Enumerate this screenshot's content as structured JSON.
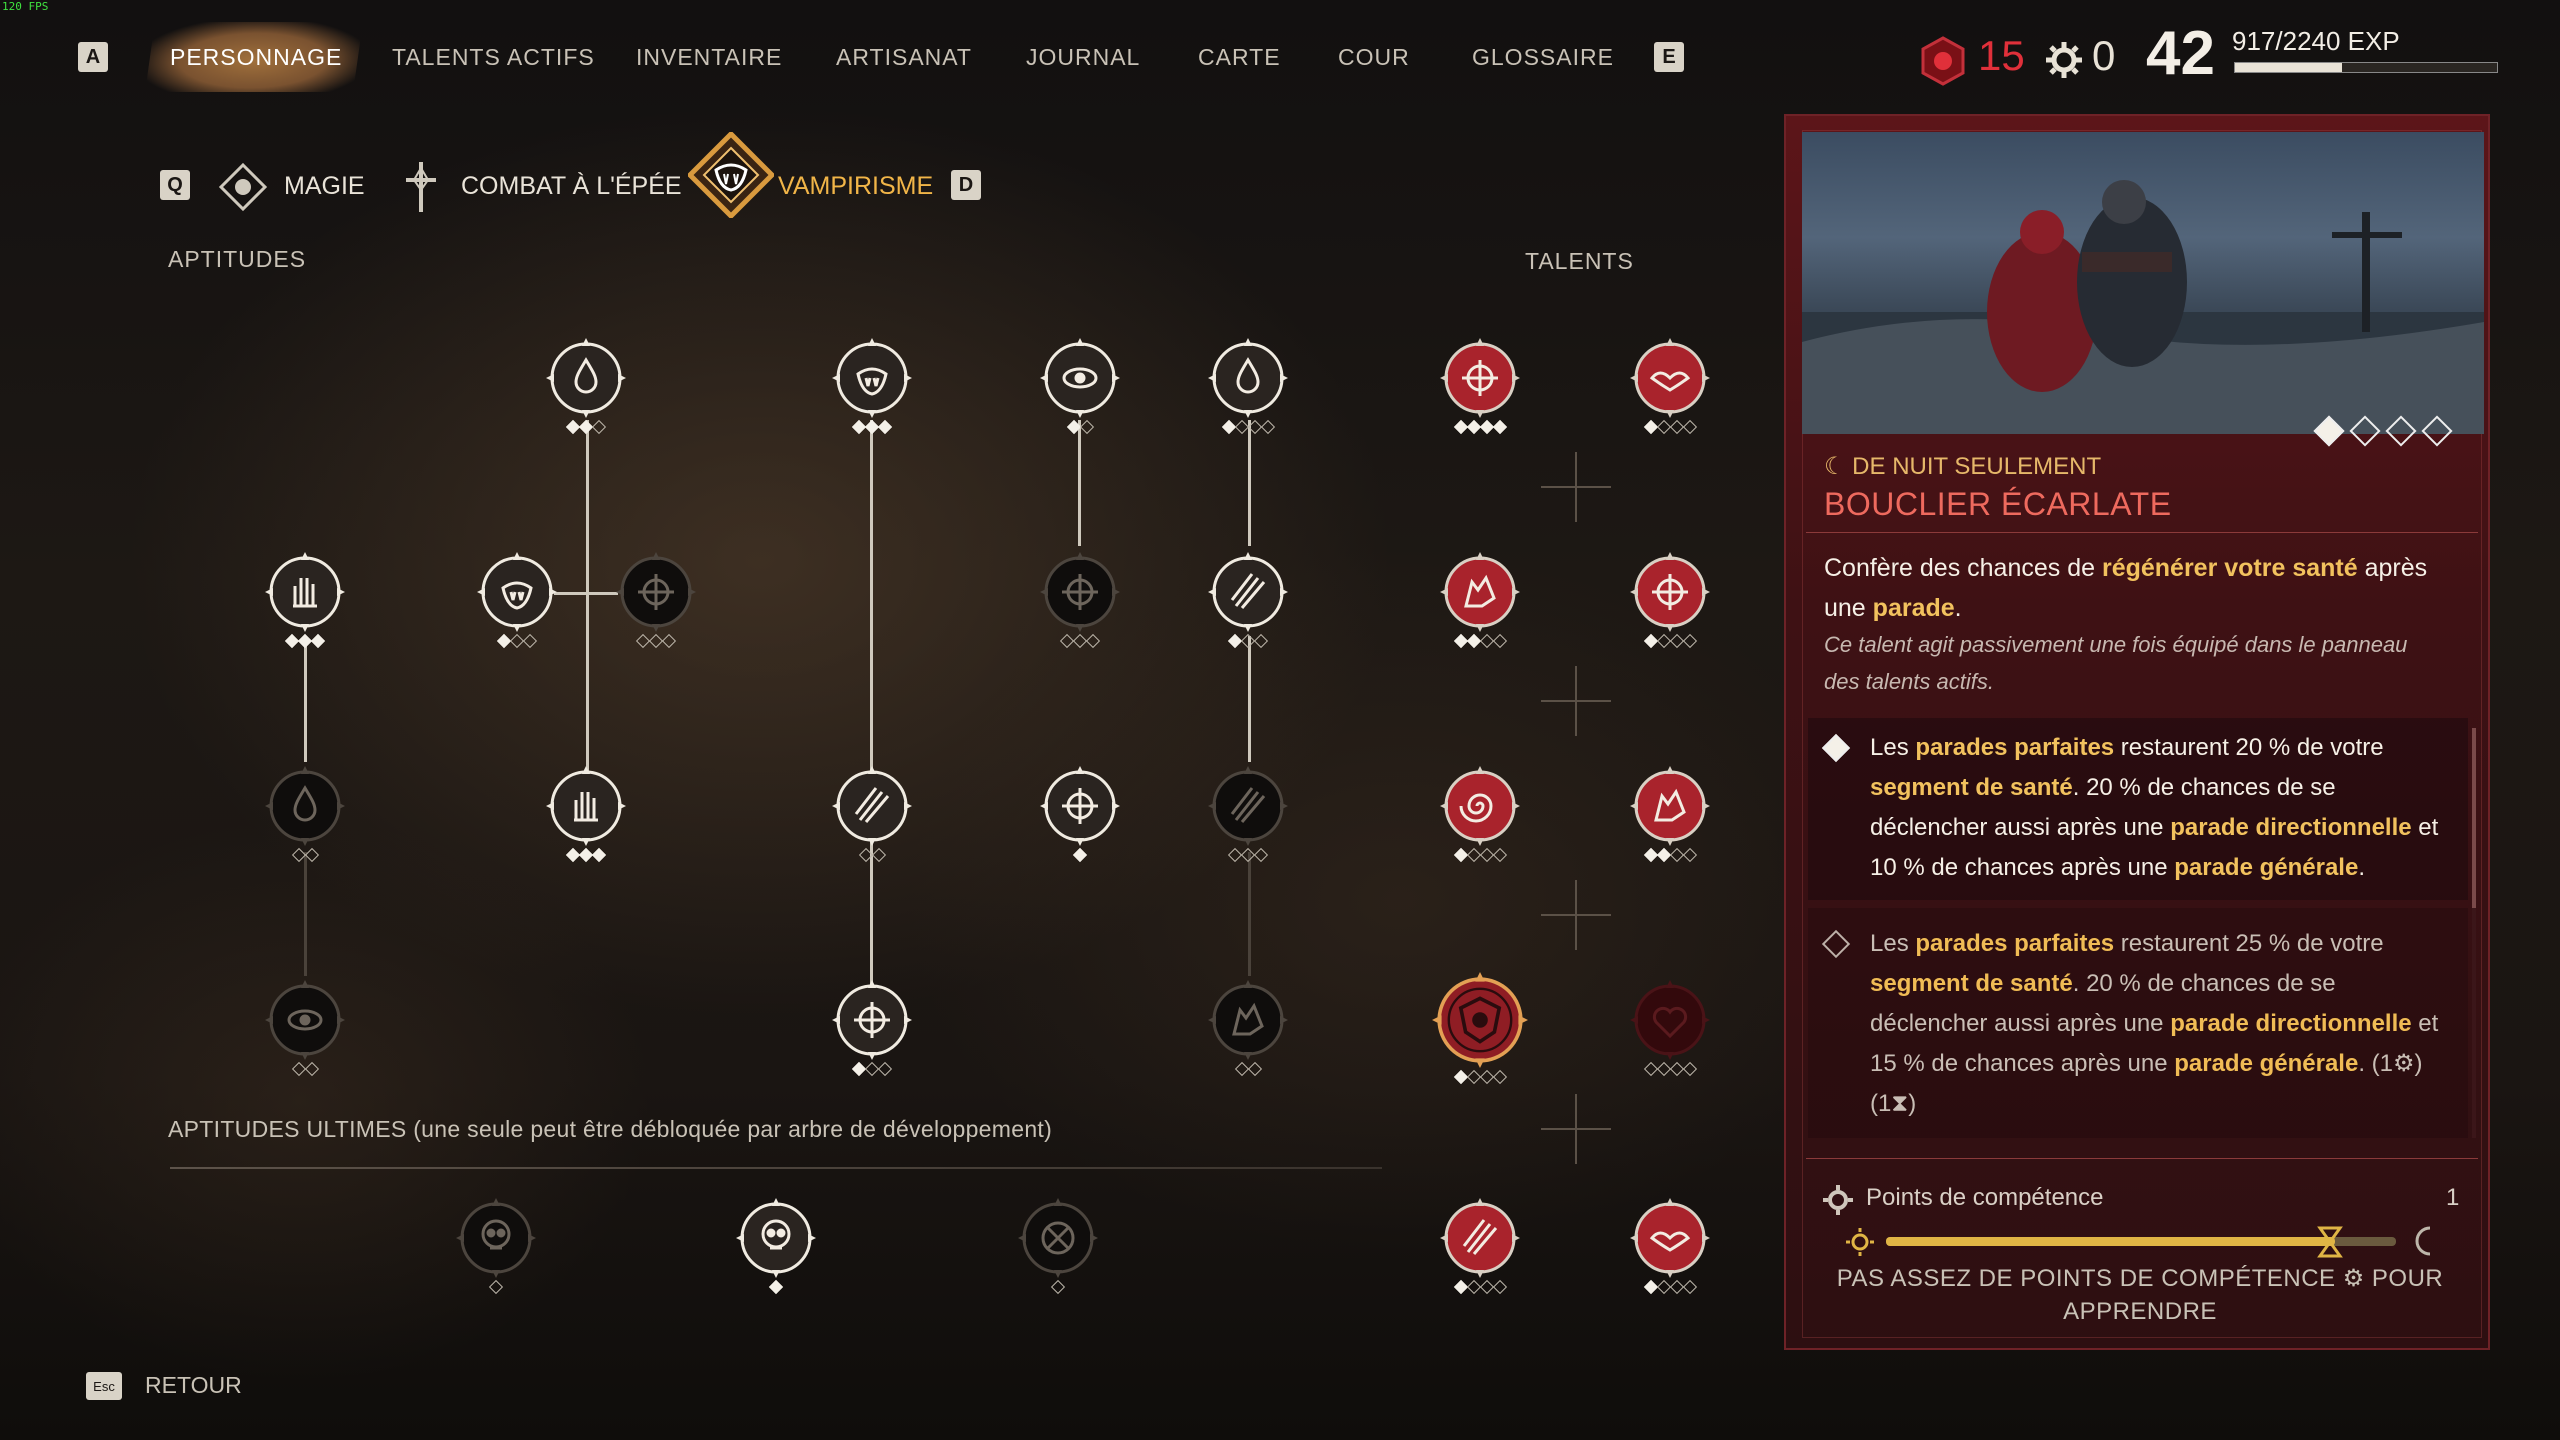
{
  "hud": {
    "fps": "120 FPS"
  },
  "nav": {
    "left_key": "A",
    "right_key": "E",
    "items": [
      "PERSONNAGE",
      "TALENTS ACTIFS",
      "INVENTAIRE",
      "ARTISANAT",
      "JOURNAL",
      "CARTE",
      "COUR",
      "GLOSSAIRE"
    ],
    "active_index": 0
  },
  "stats": {
    "blood_points": "15",
    "skill_points": "0",
    "level": "42",
    "exp": "917/2240 EXP",
    "exp_fraction": 0.409
  },
  "tree_tabs": {
    "left_key": "Q",
    "right_key": "D",
    "tabs": [
      "MAGIE",
      "COMBAT À L'ÉPÉE",
      "VAMPIRISME"
    ],
    "active_index": 2
  },
  "sections": {
    "abilities": "APTITUDES",
    "talents": "TALENTS",
    "ultimates": "APTITUDES ULTIMES (une seule peut être débloquée par arbre de développement)"
  },
  "abilities": [
    {
      "icon": "blood-drop-splash-icon",
      "ranks": 3,
      "filled": 2,
      "unlocked": true
    },
    {
      "icon": "vampire-mouth-icon",
      "ranks": 3,
      "filled": 3,
      "unlocked": true
    },
    {
      "icon": "eye-sigil-icon",
      "ranks": 2,
      "filled": 1,
      "unlocked": true
    },
    {
      "icon": "blood-drops-icon",
      "ranks": 4,
      "filled": 1,
      "unlocked": true
    },
    {
      "icon": "flame-hand-icon",
      "ranks": 3,
      "filled": 3,
      "unlocked": true
    },
    {
      "icon": "fangs-icon",
      "ranks": 3,
      "filled": 1,
      "unlocked": true
    },
    {
      "icon": "spiked-orb-icon",
      "ranks": 3,
      "filled": 0,
      "unlocked": false
    },
    {
      "icon": "hooded-figure-icon",
      "ranks": 3,
      "filled": 0,
      "unlocked": false
    },
    {
      "icon": "claw-slash-icon",
      "ranks": 3,
      "filled": 1,
      "unlocked": true
    },
    {
      "icon": "tears-drops-icon",
      "ranks": 2,
      "filled": 0,
      "unlocked": false
    },
    {
      "icon": "blood-hand-icon",
      "ranks": 3,
      "filled": 3,
      "unlocked": true
    },
    {
      "icon": "slash-marks-icon",
      "ranks": 2,
      "filled": 0,
      "unlocked": true
    },
    {
      "icon": "rose-bloom-icon",
      "ranks": 1,
      "filled": 1,
      "unlocked": true
    },
    {
      "icon": "claws-icon",
      "ranks": 3,
      "filled": 0,
      "unlocked": false
    },
    {
      "icon": "eye-portal-icon",
      "ranks": 2,
      "filled": 0,
      "unlocked": false
    },
    {
      "icon": "blood-spout-icon",
      "ranks": 3,
      "filled": 1,
      "unlocked": true
    },
    {
      "icon": "wolf-icon",
      "ranks": 2,
      "filled": 0,
      "unlocked": false
    }
  ],
  "talents": [
    {
      "icon": "blood-bloom-icon",
      "ranks": 4,
      "filled": 4,
      "state": "unlocked"
    },
    {
      "icon": "bat-wing-icon",
      "ranks": 4,
      "filled": 1,
      "state": "unlocked"
    },
    {
      "icon": "wolf-head-icon",
      "ranks": 4,
      "filled": 2,
      "state": "unlocked"
    },
    {
      "icon": "burst-icon",
      "ranks": 4,
      "filled": 1,
      "state": "unlocked"
    },
    {
      "icon": "spiral-icon",
      "ranks": 4,
      "filled": 1,
      "state": "unlocked"
    },
    {
      "icon": "howl-icon",
      "ranks": 4,
      "filled": 2,
      "state": "unlocked"
    },
    {
      "icon": "scarlet-shield-icon",
      "ranks": 4,
      "filled": 1,
      "state": "selected"
    },
    {
      "icon": "heart-icon",
      "ranks": 4,
      "filled": 0,
      "state": "locked"
    },
    {
      "icon": "blood-claw-icon",
      "ranks": 4,
      "filled": 1,
      "state": "unlocked"
    },
    {
      "icon": "bat-swarm-icon",
      "ranks": 4,
      "filled": 1,
      "state": "unlocked"
    }
  ],
  "ultimates": [
    {
      "icon": "skull-icon",
      "ranks": 1,
      "filled": 0,
      "unlocked": false
    },
    {
      "icon": "blood-skull-icon",
      "ranks": 1,
      "filled": 1,
      "unlocked": true
    },
    {
      "icon": "rune-circle-icon",
      "ranks": 1,
      "filled": 0,
      "unlocked": false
    }
  ],
  "detail": {
    "night_label": "☾ DE NUIT SEULEMENT",
    "title": "BOUCLIER ÉCARLATE",
    "rank_pips_filled": 1,
    "rank_pips_total": 4,
    "desc_parts": [
      "Confère des chances de ",
      "régénérer votre santé",
      " après une ",
      "parade",
      "."
    ],
    "passive_note": "Ce talent agit passivement une fois équipé dans le panneau des talents actifs.",
    "rank1_parts": [
      "Les ",
      "parades parfaites",
      " restaurent 20 % de votre ",
      "segment de santé",
      ". 20 % de chances de se déclencher aussi après une ",
      "parade directionnelle",
      " et 10 % de chances après une ",
      "parade générale",
      "."
    ],
    "rank2_parts": [
      "Les ",
      "parades parfaites",
      " restaurent 25 % de votre ",
      "segment de santé",
      ". 20 % de chances de se déclencher aussi après une ",
      "parade directionnelle",
      " et 15 % de chances après une ",
      "parade générale",
      ". (1⚙) (1⧗)"
    ],
    "cost_label": "Points de compétence",
    "cost_value": "1",
    "day_cycle_fraction": 0.88,
    "not_enough": "PAS ASSEZ DE POINTS DE COMPÉTENCE ⚙ POUR APPRENDRE"
  },
  "footer": {
    "back_key": "Esc",
    "back_label": "RETOUR"
  },
  "colors": {
    "accent_red": "#e0303a",
    "highlight_gold": "#f2c25e",
    "panel_red": "#5c1519"
  }
}
